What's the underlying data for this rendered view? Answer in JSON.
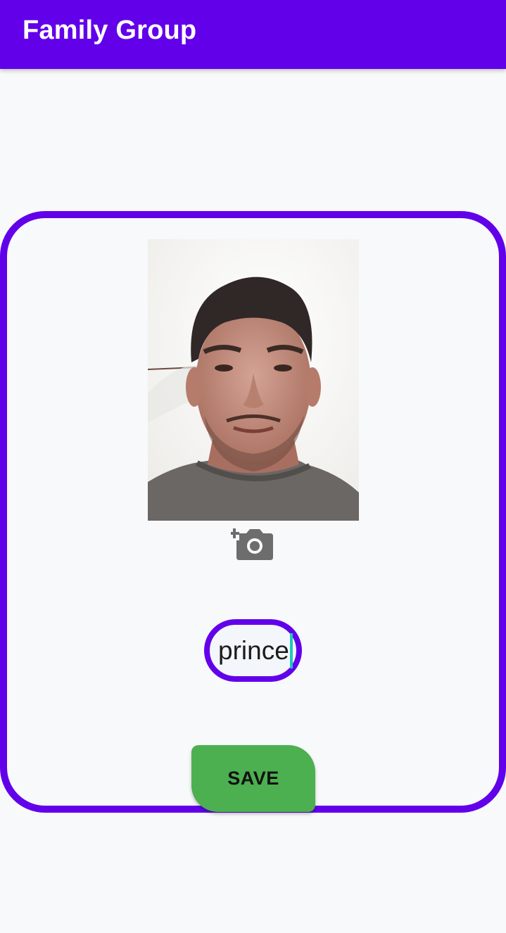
{
  "app_bar": {
    "title": "Family Group",
    "color": "#6200ea"
  },
  "profile": {
    "photo_alt": "",
    "add_photo_icon": "add-a-photo-icon"
  },
  "name_input": {
    "value": "prince"
  },
  "actions": {
    "save_label": "SAVE",
    "save_color": "#4caf50"
  }
}
